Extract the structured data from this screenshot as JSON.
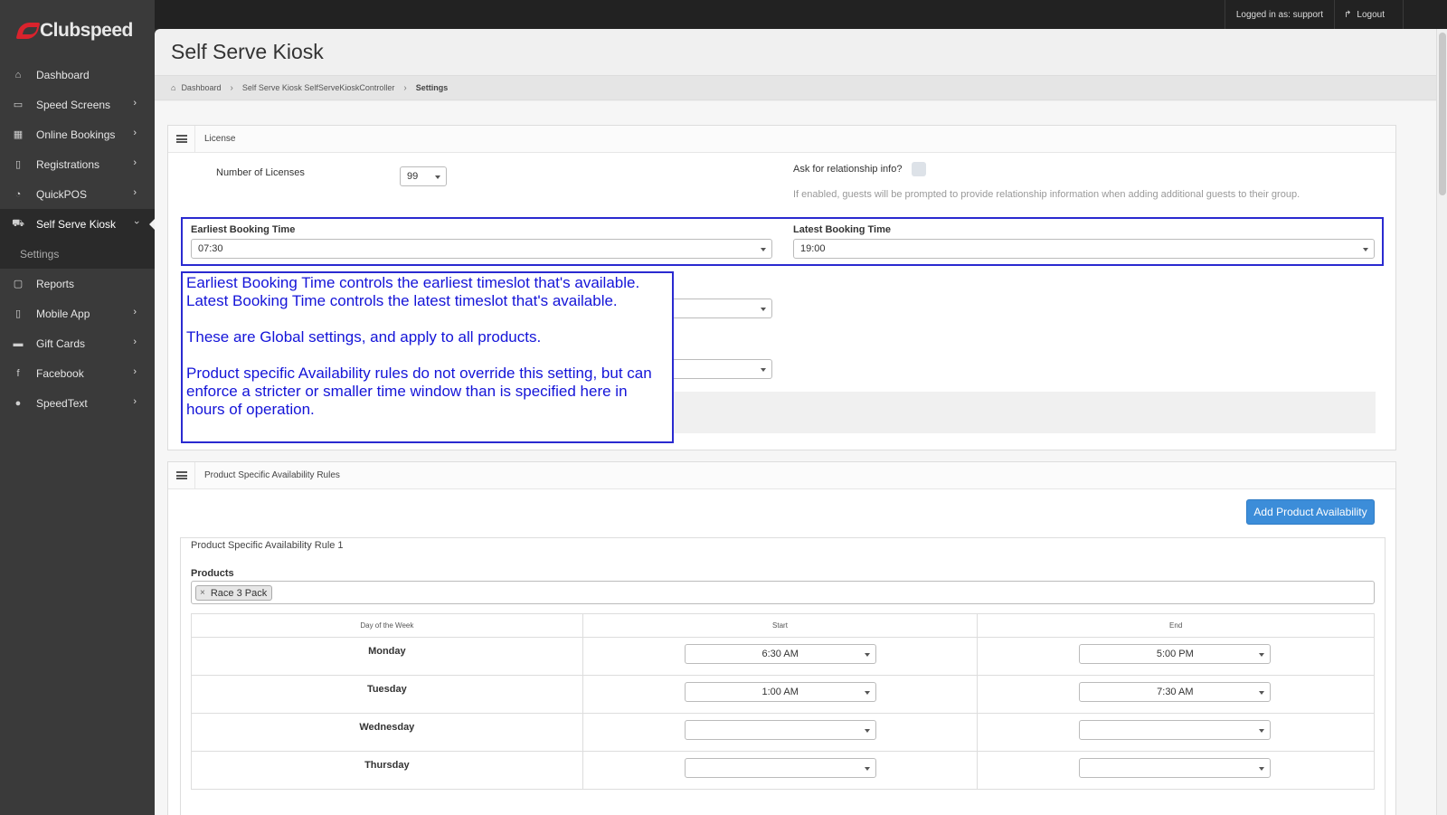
{
  "topbar": {
    "logged_in": "Logged in as: support",
    "logout": "Logout"
  },
  "brand": {
    "name": "Clubspeed",
    "accent": "#d9232d"
  },
  "sidebar": {
    "items": [
      {
        "label": "Dashboard",
        "icon": "home-icon",
        "glyph": "⌂",
        "chevron": false
      },
      {
        "label": "Speed Screens",
        "icon": "monitor-icon",
        "glyph": "▭",
        "chevron": true
      },
      {
        "label": "Online Bookings",
        "icon": "calendar-icon",
        "glyph": "▦",
        "chevron": true
      },
      {
        "label": "Registrations",
        "icon": "tablet-icon",
        "glyph": "▯",
        "chevron": true
      },
      {
        "label": "QuickPOS",
        "icon": "dashboard-icon",
        "glyph": "◔",
        "chevron": true
      },
      {
        "label": "Self Serve Kiosk",
        "icon": "cart-icon",
        "glyph": "⛟",
        "chevron": true,
        "active": true
      }
    ],
    "sub_item": "Settings",
    "items_after": [
      {
        "label": "Reports",
        "icon": "file-icon",
        "glyph": "▢",
        "chevron": false
      },
      {
        "label": "Mobile App",
        "icon": "mobile-icon",
        "glyph": "▯",
        "chevron": true
      },
      {
        "label": "Gift Cards",
        "icon": "credit-card-icon",
        "glyph": "▬",
        "chevron": true
      },
      {
        "label": "Facebook",
        "icon": "facebook-icon",
        "glyph": "f",
        "chevron": true
      },
      {
        "label": "SpeedText",
        "icon": "comments-icon",
        "glyph": "●",
        "chevron": true
      }
    ]
  },
  "page": {
    "title": "Self Serve Kiosk"
  },
  "breadcrumb": {
    "home": "Dashboard",
    "mid": "Self Serve Kiosk SelfServeKioskController",
    "current": "Settings"
  },
  "license": {
    "panel_title": "License",
    "num_licenses_label": "Number of Licenses",
    "num_licenses_value": "99",
    "relationship_label": "Ask for relationship info?",
    "relationship_help": "If enabled, guests will be prompted to provide relationship information when adding additional guests to their group.",
    "earliest_label": "Earliest Booking Time",
    "earliest_value": "07:30",
    "latest_label": "Latest Booking Time",
    "latest_value": "19:00"
  },
  "callout": {
    "p1": "Earliest Booking Time controls the earliest timeslot that's available. Latest Booking Time controls the latest timeslot that's available.",
    "p2": "These are Global settings, and apply to all products.",
    "p3": "Product specific Availability rules do not override this setting, but can enforce a stricter or smaller time window than is specified here in hours of operation."
  },
  "availability": {
    "panel_title": "Product Specific Availability Rules",
    "add_button": "Add Product Availability",
    "rule_title": "Product Specific Availability Rule 1",
    "products_label": "Products",
    "product_tag": "Race 3 Pack",
    "columns": [
      "Day of the Week",
      "Start",
      "End"
    ],
    "rows": [
      {
        "day": "Monday",
        "start": "6:30 AM",
        "end": "5:00 PM"
      },
      {
        "day": "Tuesday",
        "start": "1:00 AM",
        "end": "7:30 AM"
      },
      {
        "day": "Wednesday",
        "start": "",
        "end": ""
      },
      {
        "day": "Thursday",
        "start": "",
        "end": ""
      }
    ]
  }
}
